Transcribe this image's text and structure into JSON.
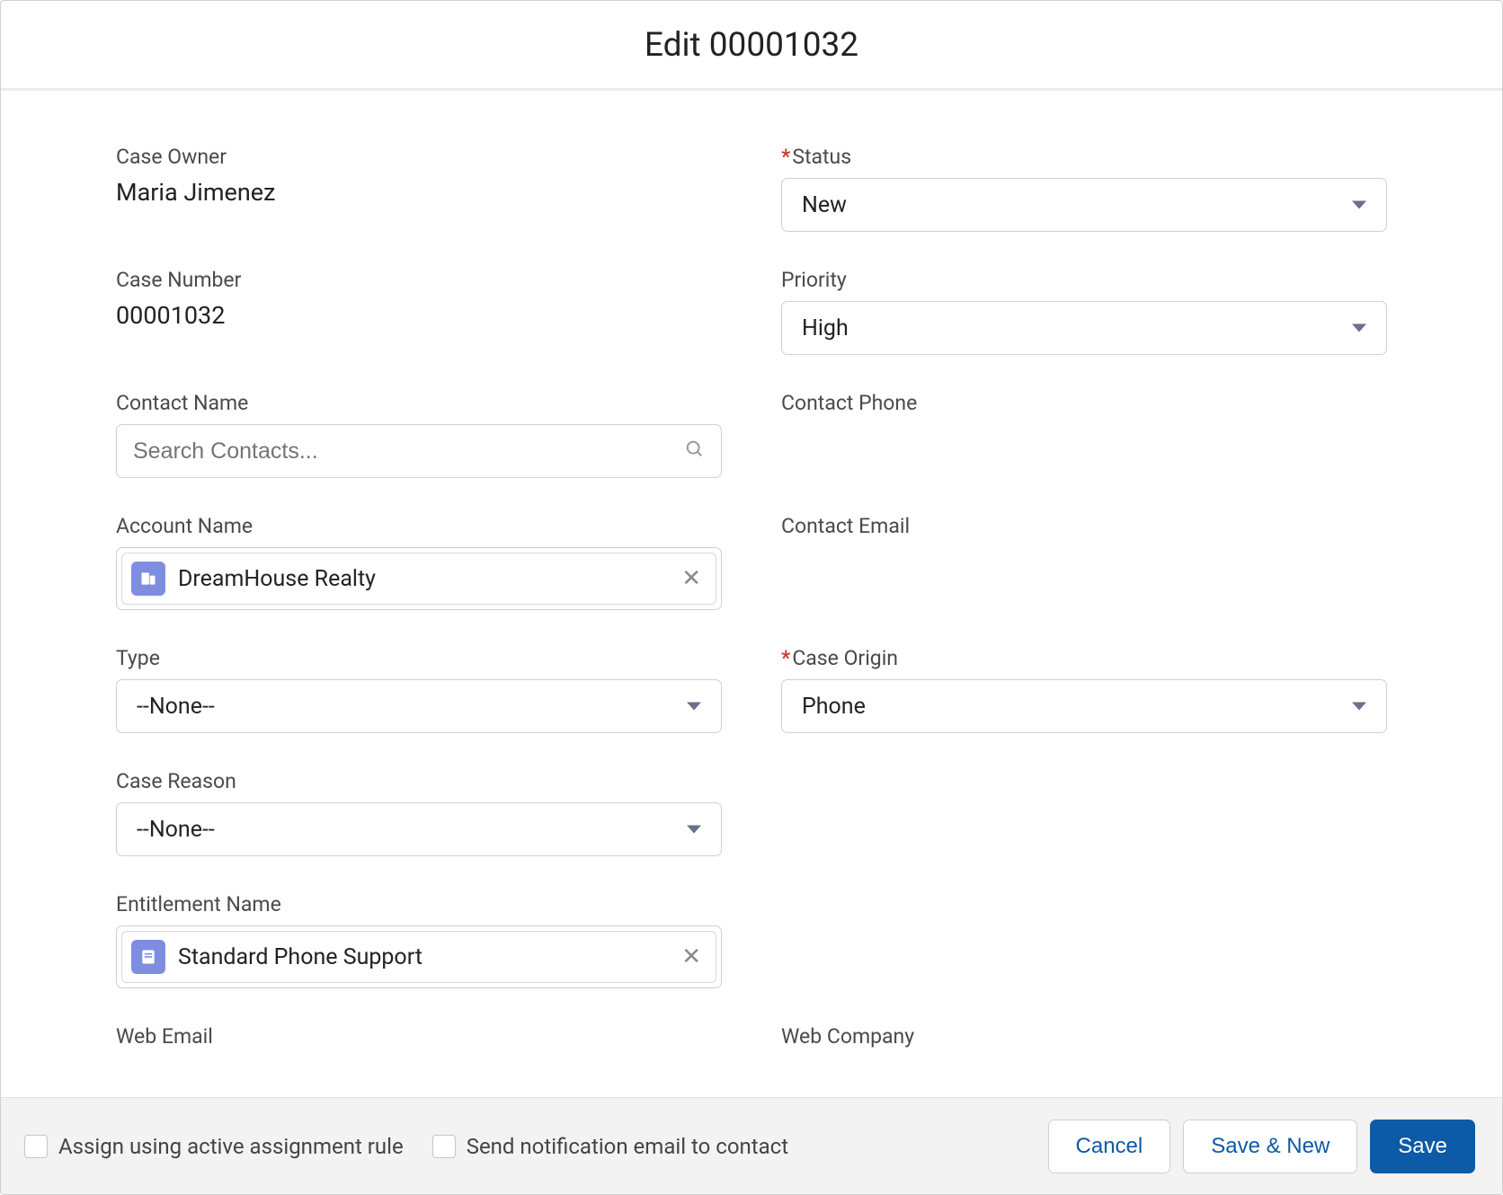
{
  "header": {
    "title": "Edit 00001032"
  },
  "fields": {
    "case_owner": {
      "label": "Case Owner",
      "value": "Maria Jimenez"
    },
    "case_number": {
      "label": "Case Number",
      "value": "00001032"
    },
    "contact_name": {
      "label": "Contact Name",
      "placeholder": "Search Contacts..."
    },
    "account_name": {
      "label": "Account Name",
      "value": "DreamHouse Realty"
    },
    "type": {
      "label": "Type",
      "value": "--None--"
    },
    "case_reason": {
      "label": "Case Reason",
      "value": "--None--"
    },
    "entitlement_name": {
      "label": "Entitlement Name",
      "value": "Standard Phone Support"
    },
    "status": {
      "label": "Status",
      "value": "New"
    },
    "priority": {
      "label": "Priority",
      "value": "High"
    },
    "contact_phone": {
      "label": "Contact Phone"
    },
    "contact_email": {
      "label": "Contact Email"
    },
    "case_origin": {
      "label": "Case Origin",
      "value": "Phone"
    },
    "web_email": {
      "label": "Web Email"
    },
    "web_company": {
      "label": "Web Company"
    }
  },
  "footer": {
    "assign_rule_label": "Assign using active assignment rule",
    "send_notification_label": "Send notification email to contact",
    "cancel": "Cancel",
    "save_new": "Save & New",
    "save": "Save"
  }
}
